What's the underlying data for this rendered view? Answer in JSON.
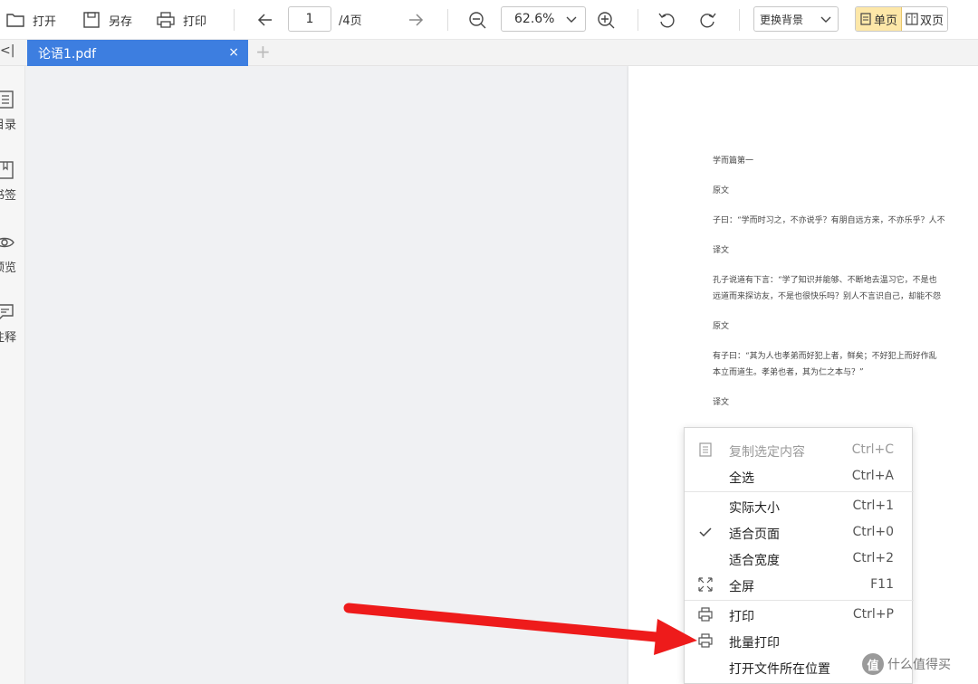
{
  "toolbar": {
    "open_label": "打开",
    "save_as_label": "另存",
    "print_label": "打印",
    "current_page": "1",
    "total_pages": "/4页",
    "zoom": "62.6%",
    "background_label": "更换背景",
    "single_page_label": "单页",
    "double_page_label": "双页"
  },
  "tabs": {
    "collapse_label": "<|",
    "active_tab": "论语1.pdf",
    "close_label": "×",
    "new_tab_label": "+"
  },
  "sidebar": {
    "items": [
      {
        "label": "目录",
        "icon": "toc-icon"
      },
      {
        "label": "书签",
        "icon": "bookmark-icon"
      },
      {
        "label": "预览",
        "icon": "eye-icon"
      },
      {
        "label": "注释",
        "icon": "comment-icon"
      }
    ]
  },
  "document": {
    "lines": [
      "学而篇第一",
      "原文",
      "子曰：“学而时习之，不亦说乎？有朋自远方来，不亦乐乎？人不",
      "译文",
      "孔子说道有下言：“学了知识并能够、不断地去温习它，不是也",
      "远道而来探访友，不是也很快乐吗？别人不言识自己，却能不怨",
      "原文",
      "有子曰：“其为人也孝弟而好犯上者，鲜矣；不好犯上而好作乱",
      "本立而道生。孝弟也者，其为仁之本与？”",
      "译文"
    ]
  },
  "context_menu": {
    "items": [
      {
        "label": "复制选定内容",
        "shortcut": "Ctrl+C",
        "icon": "copy-icon",
        "disabled": true
      },
      {
        "label": "全选",
        "shortcut": "Ctrl+A",
        "icon": "",
        "disabled": false
      },
      {
        "label": "实际大小",
        "shortcut": "Ctrl+1",
        "icon": "",
        "disabled": false
      },
      {
        "label": "适合页面",
        "shortcut": "Ctrl+0",
        "icon": "check-icon",
        "disabled": false
      },
      {
        "label": "适合宽度",
        "shortcut": "Ctrl+2",
        "icon": "",
        "disabled": false
      },
      {
        "label": "全屏",
        "shortcut": "F11",
        "icon": "fullscreen-icon",
        "disabled": false
      },
      {
        "label": "打印",
        "shortcut": "Ctrl+P",
        "icon": "printer-icon",
        "disabled": false
      },
      {
        "label": "批量打印",
        "shortcut": "",
        "icon": "printer-icon",
        "disabled": false
      },
      {
        "label": "打开文件所在位置",
        "shortcut": "",
        "icon": "",
        "disabled": false
      }
    ]
  },
  "watermark": {
    "badge": "值",
    "text": "什么值得买"
  },
  "colors": {
    "tab_active": "#3d7ee0",
    "view_active": "#fde7a8",
    "arrow": "#ee1b1b"
  }
}
